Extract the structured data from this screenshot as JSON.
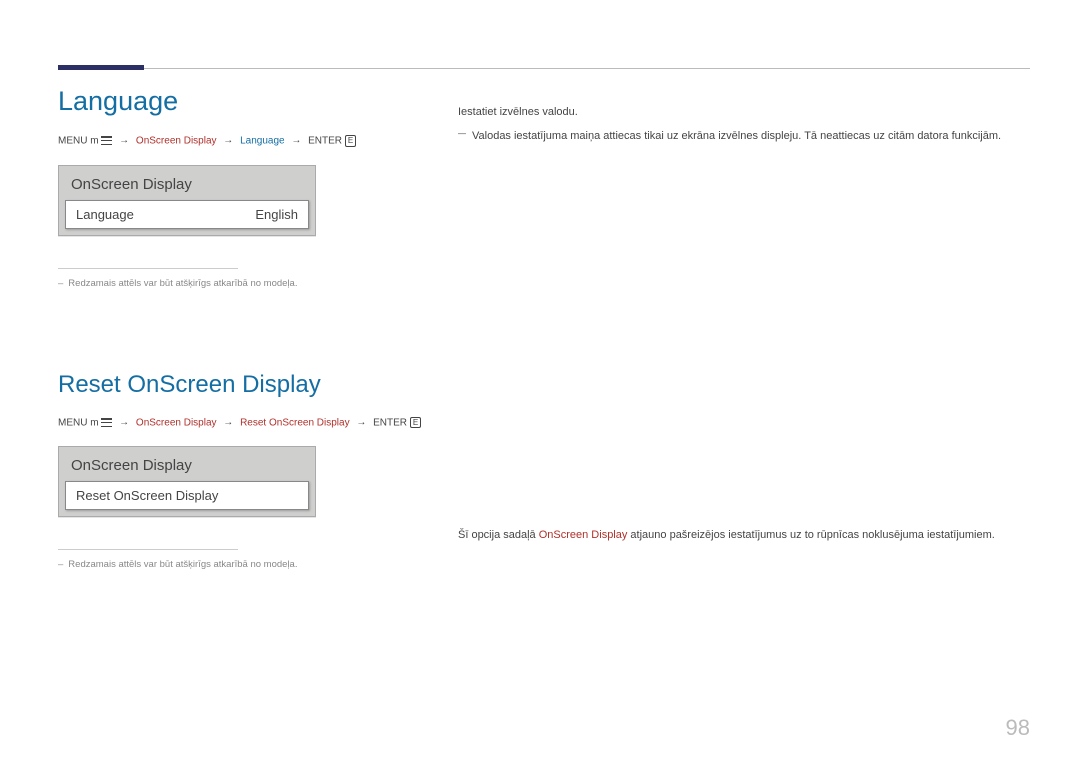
{
  "language": {
    "title": "Language",
    "breadcrumb": {
      "menu": "MENU",
      "m_prefix": "m",
      "osd": "OnScreen Display",
      "current": "Language",
      "enter": "ENTER",
      "enter_sym": "E"
    },
    "panel": {
      "header": "OnScreen Display",
      "row_label": "Language",
      "row_value": "English"
    },
    "footnote": "Redzamais attēls var būt atšķirīgs atkarībā no modeļa.",
    "right": {
      "line1": "Iestatiet izvēlnes valodu.",
      "note": "Valodas iestatījuma maiņa attiecas tikai uz ekrāna izvēlnes displeju. Tā neattiecas uz citām datora funkcijām."
    }
  },
  "reset": {
    "title": "Reset OnScreen Display",
    "breadcrumb": {
      "menu": "MENU",
      "m_prefix": "m",
      "osd1": "OnScreen Display",
      "osd2": "Reset OnScreen Display",
      "enter": "ENTER",
      "enter_sym": "E"
    },
    "panel": {
      "header": "OnScreen Display",
      "row_label": "Reset OnScreen Display"
    },
    "footnote": "Redzamais attēls var būt atšķirīgs atkarībā no modeļa.",
    "right": {
      "text_a": "Šī opcija sadaļā ",
      "text_b": "OnScreen Display",
      "text_c": " atjauno pašreizējos iestatījumus uz to rūpnīcas noklusējuma iestatījumiem."
    }
  },
  "page": "98"
}
